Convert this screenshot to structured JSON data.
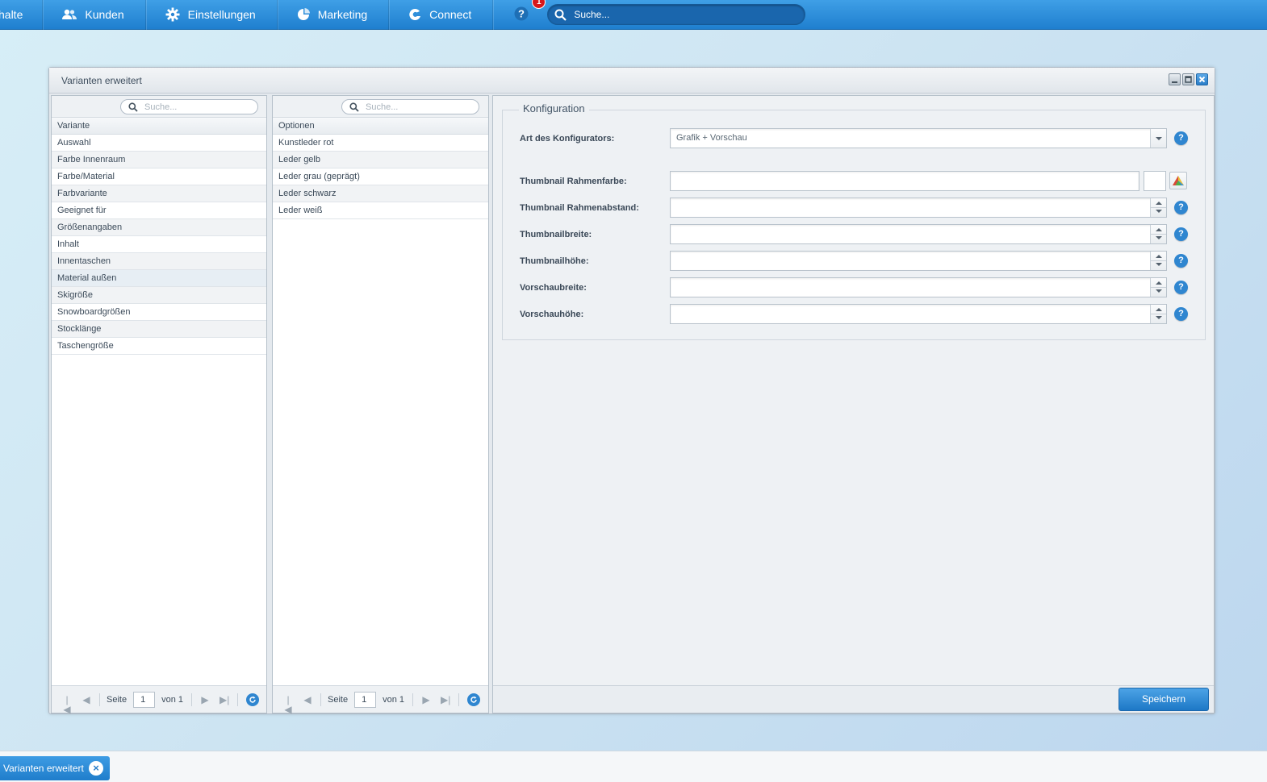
{
  "topbar": {
    "items": [
      {
        "label": "halte",
        "icon": "none"
      },
      {
        "label": "Kunden",
        "icon": "users-icon"
      },
      {
        "label": "Einstellungen",
        "icon": "gear-icon"
      },
      {
        "label": "Marketing",
        "icon": "pie-chart-icon"
      },
      {
        "label": "Connect",
        "icon": "connect-icon"
      }
    ],
    "notification_count": "1",
    "search_placeholder": "Suche..."
  },
  "window": {
    "title": "Varianten erweitert"
  },
  "variants_panel": {
    "search_placeholder": "Suche...",
    "column_header": "Variante",
    "rows": [
      "Auswahl",
      "Farbe Innenraum",
      "Farbe/Material",
      "Farbvariante",
      "Geeignet für",
      "Größenangaben",
      "Inhalt",
      "Innentaschen",
      "Material außen",
      "Skigröße",
      "Snowboardgrößen",
      "Stocklänge",
      "Taschengröße"
    ],
    "selected_row": "Material außen",
    "pager": {
      "page_label": "Seite",
      "page_value": "1",
      "of_label": "von 1"
    }
  },
  "options_panel": {
    "search_placeholder": "Suche...",
    "column_header": "Optionen",
    "rows": [
      "Kunstleder rot",
      "Leder gelb",
      "Leder grau (geprägt)",
      "Leder schwarz",
      "Leder weiß"
    ],
    "pager": {
      "page_label": "Seite",
      "page_value": "1",
      "of_label": "von 1"
    }
  },
  "config": {
    "legend": "Konfiguration",
    "configurator_type_label": "Art des Konfigurators:",
    "configurator_type_value": "Grafik + Vorschau",
    "thumb_border_color_label": "Thumbnail Rahmenfarbe:",
    "thumb_border_spacing_label": "Thumbnail Rahmenabstand:",
    "thumb_width_label": "Thumbnailbreite:",
    "thumb_height_label": "Thumbnailhöhe:",
    "preview_width_label": "Vorschaubreite:",
    "preview_height_label": "Vorschauhöhe:",
    "help_glyph": "?",
    "save_label": "Speichern"
  },
  "taskbar": {
    "item_label": "Varianten erweitert"
  },
  "colors": {
    "accent": "#2f86d0",
    "topbar": "#2a8ad8",
    "badge": "#d8171b"
  }
}
